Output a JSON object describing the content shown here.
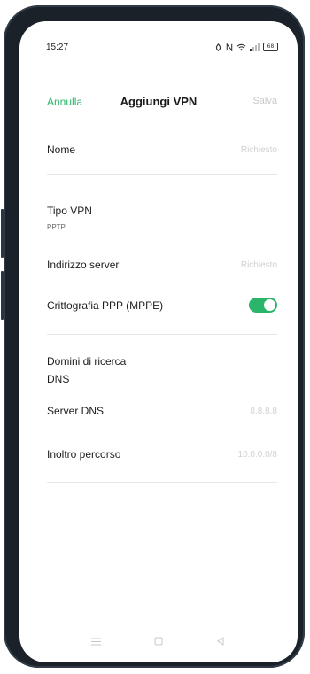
{
  "status_bar": {
    "time": "15:27",
    "battery": "68"
  },
  "header": {
    "cancel_label": "Annulla",
    "title": "Aggiungi VPN",
    "save_label": "Salva"
  },
  "form": {
    "name": {
      "label": "Nome",
      "placeholder": "Richiesto"
    },
    "vpn_type": {
      "label": "Tipo VPN",
      "value": "PPTP"
    },
    "server_address": {
      "label": "Indirizzo server",
      "placeholder": "Richiesto"
    },
    "encryption": {
      "label": "Crittografia PPP (MPPE)",
      "enabled": true
    },
    "dns_search_domains": {
      "label_line1": "Domini di ricerca",
      "label_line2": "DNS"
    },
    "dns_servers": {
      "label": "Server DNS",
      "placeholder": "8.8.8.8"
    },
    "forwarding_routes": {
      "label": "Inoltro percorso",
      "placeholder": "10.0.0.0/8"
    }
  },
  "colors": {
    "accent": "#2bb56b",
    "placeholder": "#d0d0d0",
    "divider": "#e8e8e8",
    "device_frame": "#1b2128"
  },
  "icons": [
    "do-not-disturb-icon",
    "nfc-icon",
    "wifi-icon",
    "signal-icon",
    "battery-icon",
    "menu-icon",
    "home-icon",
    "back-icon"
  ]
}
